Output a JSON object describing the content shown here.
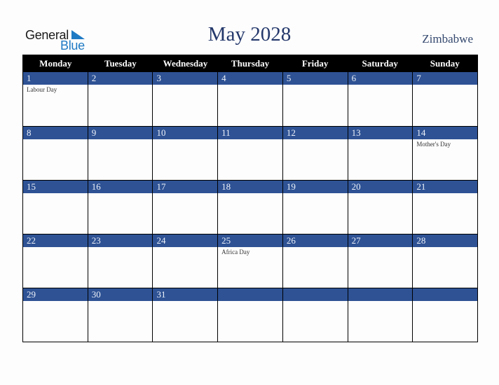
{
  "logo": {
    "general": "General",
    "blue": "Blue"
  },
  "title": "May 2028",
  "country": "Zimbabwe",
  "weekdays": [
    "Monday",
    "Tuesday",
    "Wednesday",
    "Thursday",
    "Friday",
    "Saturday",
    "Sunday"
  ],
  "weeks": [
    [
      {
        "day": "1",
        "event": "Labour Day"
      },
      {
        "day": "2",
        "event": ""
      },
      {
        "day": "3",
        "event": ""
      },
      {
        "day": "4",
        "event": ""
      },
      {
        "day": "5",
        "event": ""
      },
      {
        "day": "6",
        "event": ""
      },
      {
        "day": "7",
        "event": ""
      }
    ],
    [
      {
        "day": "8",
        "event": ""
      },
      {
        "day": "9",
        "event": ""
      },
      {
        "day": "10",
        "event": ""
      },
      {
        "day": "11",
        "event": ""
      },
      {
        "day": "12",
        "event": ""
      },
      {
        "day": "13",
        "event": ""
      },
      {
        "day": "14",
        "event": "Mother's Day"
      }
    ],
    [
      {
        "day": "15",
        "event": ""
      },
      {
        "day": "16",
        "event": ""
      },
      {
        "day": "17",
        "event": ""
      },
      {
        "day": "18",
        "event": ""
      },
      {
        "day": "19",
        "event": ""
      },
      {
        "day": "20",
        "event": ""
      },
      {
        "day": "21",
        "event": ""
      }
    ],
    [
      {
        "day": "22",
        "event": ""
      },
      {
        "day": "23",
        "event": ""
      },
      {
        "day": "24",
        "event": ""
      },
      {
        "day": "25",
        "event": "Africa Day"
      },
      {
        "day": "26",
        "event": ""
      },
      {
        "day": "27",
        "event": ""
      },
      {
        "day": "28",
        "event": ""
      }
    ],
    [
      {
        "day": "29",
        "event": ""
      },
      {
        "day": "30",
        "event": ""
      },
      {
        "day": "31",
        "event": ""
      },
      {
        "day": "",
        "event": ""
      },
      {
        "day": "",
        "event": ""
      },
      {
        "day": "",
        "event": ""
      },
      {
        "day": "",
        "event": ""
      }
    ]
  ]
}
